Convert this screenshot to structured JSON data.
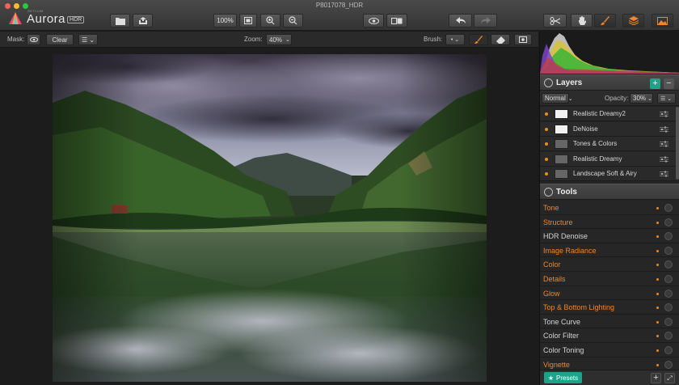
{
  "window": {
    "title": "P8017078_HDR"
  },
  "app": {
    "small_label": "SKYLUM",
    "name": "Aurora",
    "badge": "HDR"
  },
  "toolbar": {
    "zoom_percent": "100%"
  },
  "options": {
    "mask_label": "Mask:",
    "clear_label": "Clear",
    "zoom_label": "Zoom:",
    "zoom_value": "40%",
    "brush_label": "Brush:"
  },
  "layers": {
    "title": "Layers",
    "blend_mode": "Normal",
    "opacity_label": "Opacity:",
    "opacity_value": "30%",
    "items": [
      {
        "label": "Realistic Dreamy2"
      },
      {
        "label": "DeNoise"
      },
      {
        "label": "Tones & Colors"
      },
      {
        "label": "Realistic Dreamy"
      },
      {
        "label": "Landscape Soft & Airy"
      }
    ]
  },
  "tools": {
    "title": "Tools",
    "items": [
      {
        "label": "Tone",
        "active": true
      },
      {
        "label": "Structure",
        "active": true
      },
      {
        "label": "HDR Denoise",
        "active": false
      },
      {
        "label": "Image Radiance",
        "active": true
      },
      {
        "label": "Color",
        "active": true
      },
      {
        "label": "Details",
        "active": true
      },
      {
        "label": "Glow",
        "active": true
      },
      {
        "label": "Top & Bottom Lighting",
        "active": true
      },
      {
        "label": "Tone Curve",
        "active": false
      },
      {
        "label": "Color Filter",
        "active": false
      },
      {
        "label": "Color Toning",
        "active": false
      },
      {
        "label": "Vignette",
        "active": true
      }
    ]
  },
  "footer": {
    "presets_label": "Presets"
  },
  "colors": {
    "accent": "#f0862a",
    "presets": "#1aa58a"
  }
}
